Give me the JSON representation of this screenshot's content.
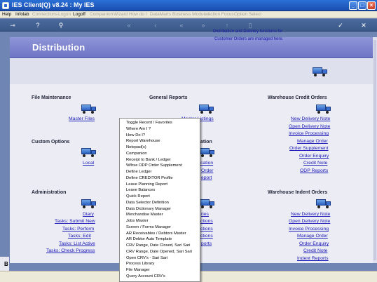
{
  "window": {
    "title": "IES Client(Q) v8.24 : My IES"
  },
  "menubar": {
    "items": [
      {
        "label": "Help",
        "disabled": false
      },
      {
        "label": "Infolab",
        "disabled": false
      },
      {
        "label": "Connections",
        "disabled": true
      },
      {
        "label": "Logon",
        "disabled": true
      },
      {
        "label": "Logoff",
        "disabled": false
      },
      {
        "label": "Companion",
        "disabled": true
      },
      {
        "label": "Wizard",
        "disabled": true
      },
      {
        "label": "How do I",
        "disabled": true
      },
      {
        "label": "DataMarts",
        "disabled": true
      },
      {
        "label": "Business Modules",
        "disabled": true
      },
      {
        "label": "Action Focus",
        "disabled": true
      },
      {
        "label": "Option Select",
        "disabled": true
      }
    ]
  },
  "toolbar": {
    "icons": [
      "key-icon",
      "help-icon",
      "search-icon",
      "first-icon",
      "back-icon",
      "forward-icon",
      "last-icon",
      "up-icon",
      "doc-icon",
      "check-icon",
      "close-icon"
    ]
  },
  "page": {
    "heading": "Distribution",
    "intro_line1": "Distribution and Delivery functions for",
    "intro_line2": "Customer Orders are managed here."
  },
  "sections": {
    "file_maintenance": {
      "title": "File Maintenance",
      "links": [
        "Master Files"
      ]
    },
    "general_reports": {
      "title": "General Reports",
      "links": [
        "Master Listings"
      ]
    },
    "warehouse_credit": {
      "title": "Warehouse Credit Orders",
      "links": [
        "New Delivery Note",
        "Open Delivery Note",
        "Invoice Processing",
        "Manage Order",
        "Order Supplement",
        "Order Enquiry",
        "Credit Note",
        "ODP Reports"
      ]
    },
    "custom_options": {
      "title": "Custom Options",
      "links": [
        "Local"
      ]
    },
    "middle_mid": {
      "title_fragment": "ation",
      "links": [
        "cation",
        "Order",
        "eport"
      ]
    },
    "administration": {
      "title": "Administration",
      "links": [
        "Diary",
        "Tasks: Submit New",
        "Tasks: Perform",
        "Tasks: Edit",
        "Tasks: List Active",
        "Tasks: Check Progress"
      ]
    },
    "middle_bottom": {
      "links": [
        "ries",
        "ctions",
        "ctions",
        "ctions",
        "ports"
      ]
    },
    "warehouse_indent": {
      "title": "Warehouse Indent Orders",
      "links": [
        "New Delivery Note",
        "Open Delivery Note",
        "Invoice Processing",
        "Manage Order",
        "Order Enquiry",
        "Credit Note",
        "Indent Reports"
      ]
    }
  },
  "context_menu": {
    "items": [
      "Toggle Recent / Favorites",
      "Where Am I ?",
      "How Do I?",
      "Report Warehouse",
      "Notepad(s)",
      "Companion",
      "Receipt to Bank / Ledger",
      "W/hse ODP Order Supplement",
      "Define Ledger",
      "Define CREDITOR Profile",
      "Leave Planning Report",
      "Leave Balances",
      "Quick Report",
      "Data Selector Definition",
      "Data Dictionary Manager",
      "Merchandise Master",
      "Jobs Master",
      "Screen / Forms Manager",
      "AR Receivables / Debtors Master",
      "AR Debtor Auto Template",
      "CRV Range, Date Closed, Sari Sari",
      "CRV Range, Date Opened, Sari Sari",
      "Open CRV's - Sari Sari",
      "Process Library",
      "File Manager",
      "Query Account CRV's"
    ]
  },
  "left_edge": {
    "letter": "B"
  }
}
